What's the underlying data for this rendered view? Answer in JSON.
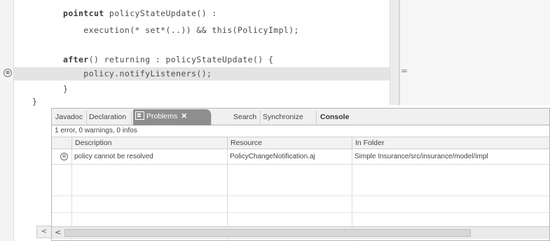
{
  "editor": {
    "lines": [
      {
        "kw": "pointcut",
        "text": " policyStateUpdate() :"
      },
      {
        "kw": "",
        "text": "    execution(* set*(..)) && this(PolicyImpl);"
      },
      {
        "kw": "",
        "text": ""
      },
      {
        "kw": "after",
        "text": "() returning : policyStateUpdate() {"
      },
      {
        "kw": "",
        "text": "    policy.notifyListeners();"
      },
      {
        "kw": "",
        "text": "}"
      },
      {
        "kw": "",
        "text": "}"
      }
    ],
    "error_marker": "⊗",
    "scroll_left_glyph": "<",
    "sash_glyph": "="
  },
  "problems_view": {
    "tabs": [
      {
        "label": "Javadoc"
      },
      {
        "label": "Declaration"
      },
      {
        "label": "Problems",
        "close": "✕"
      },
      {
        "label": "Search"
      },
      {
        "label": "Synchronize"
      },
      {
        "label": "Console"
      }
    ],
    "summary": "1 error, 0 warnings, 0 infos",
    "columns": [
      "Description",
      "Resource",
      "In Folder"
    ],
    "rows": [
      {
        "icon": "⊗",
        "description": "policy cannot be resolved",
        "resource": "PolicyChangeNotification.aj",
        "folder": "Simple Insurance/src/insurance/model/impl"
      }
    ],
    "scroll_left": "<"
  }
}
